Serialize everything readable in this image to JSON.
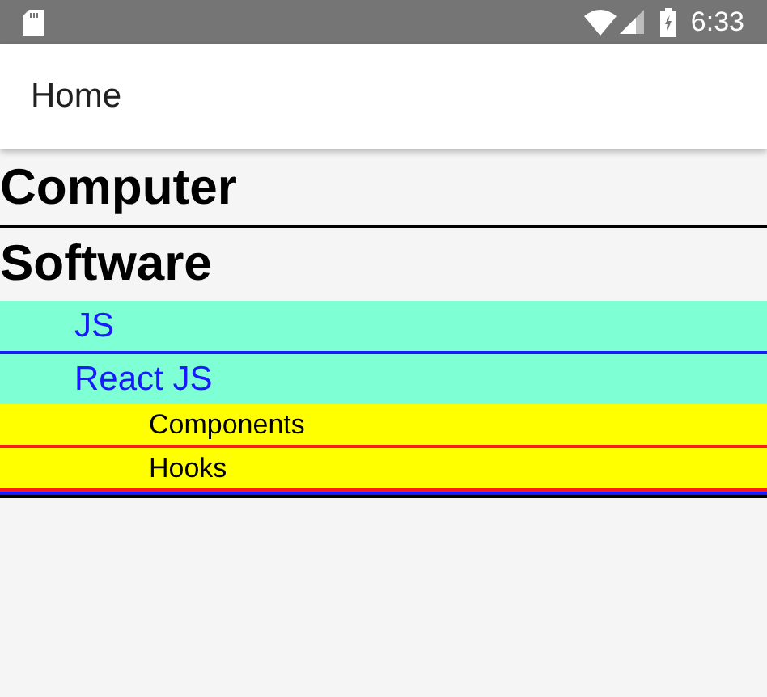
{
  "status_bar": {
    "time": "6:33"
  },
  "app_bar": {
    "title": "Home"
  },
  "tree": [
    {
      "label": "Computer"
    },
    {
      "label": "Software",
      "children": [
        {
          "label": "JS"
        },
        {
          "label": "React JS",
          "children": [
            {
              "label": "Components"
            },
            {
              "label": "Hooks"
            }
          ]
        }
      ]
    }
  ]
}
